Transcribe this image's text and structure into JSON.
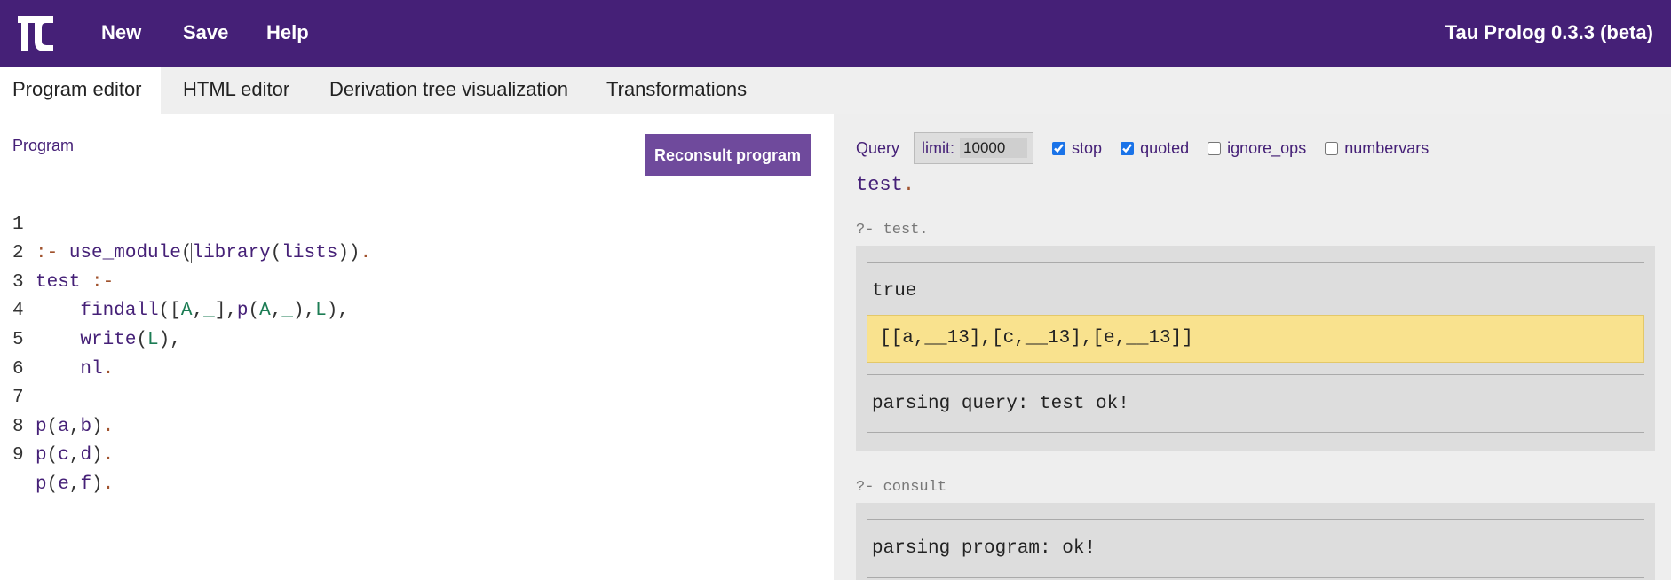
{
  "header": {
    "nav": [
      "New",
      "Save",
      "Help"
    ],
    "version": "Tau Prolog 0.3.3 (beta)"
  },
  "tabs": [
    "Program editor",
    "HTML editor",
    "Derivation tree visualization",
    "Transformations"
  ],
  "editor": {
    "label": "Program",
    "reconsult_label": "Reconsult program",
    "line_numbers": [
      "1",
      "2",
      "3",
      "4",
      "5",
      "6",
      "7",
      "8",
      "9"
    ]
  },
  "query": {
    "label": "Query",
    "limit_label": "limit:",
    "limit_value": "10000",
    "options": [
      {
        "label": "stop",
        "checked": true
      },
      {
        "label": "quoted",
        "checked": true
      },
      {
        "label": "ignore_ops",
        "checked": false
      },
      {
        "label": "numbervars",
        "checked": false
      }
    ],
    "text": "test"
  },
  "results": {
    "test_header": "?- test.",
    "true": "true",
    "output": "[[a,__13],[c,__13],[e,__13]]",
    "parsing_query": "parsing query: test ok!",
    "consult_header": "?- consult",
    "parsing_program": "parsing program: ok!"
  },
  "colors": {
    "brand": "#452077",
    "button": "#6f4a9c",
    "highlight": "#f9e28e"
  }
}
